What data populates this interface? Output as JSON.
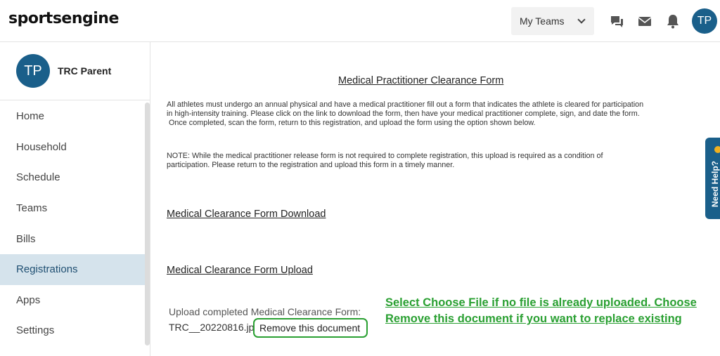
{
  "header": {
    "logo_text": "sportsengine",
    "my_teams_label": "My Teams",
    "avatar_initials": "TP"
  },
  "sidebar": {
    "user_initials": "TP",
    "user_name": "TRC Parent",
    "items": [
      {
        "label": "Home"
      },
      {
        "label": "Household"
      },
      {
        "label": "Schedule"
      },
      {
        "label": "Teams"
      },
      {
        "label": "Bills"
      },
      {
        "label": "Registrations",
        "active": true
      },
      {
        "label": "Apps"
      },
      {
        "label": "Settings"
      }
    ]
  },
  "main": {
    "form_title": "Medical Practitioner Clearance Form",
    "intro_lines": [
      "All athletes must undergo an annual physical and have a medical practitioner fill out a form that indicates the athlete is cleared for participation",
      "in high-intensity training.  Please click on the link to download the form, then have your medical practitioner complete, sign, and date the form.",
      " Once completed, scan the form, return to this registration, and upload the form using the option shown below."
    ],
    "note_lines": [
      "NOTE: While the medical practitioner release form is not required to complete registration, this upload is required as a condition of",
      "participation.  Please return to the registration and upload this form in a timely manner."
    ],
    "download_heading": "Medical Clearance Form Download",
    "upload_heading": "Medical Clearance Form Upload",
    "upload_label": "Upload completed Medical Clearance Form:",
    "uploaded_file": "TRC__20220816.jpg",
    "remove_label": "Remove this document"
  },
  "annotation": {
    "lines": [
      "Select Choose File if no file is already uploaded.  Choose",
      "Remove this document if you want to replace existing"
    ],
    "color": "#2aa032"
  },
  "help_tab": {
    "label": "Need Help?"
  },
  "colors": {
    "accent": "#1a5f8a",
    "active_nav_bg": "#d5e3ec",
    "annotation_green": "#2aa032"
  }
}
